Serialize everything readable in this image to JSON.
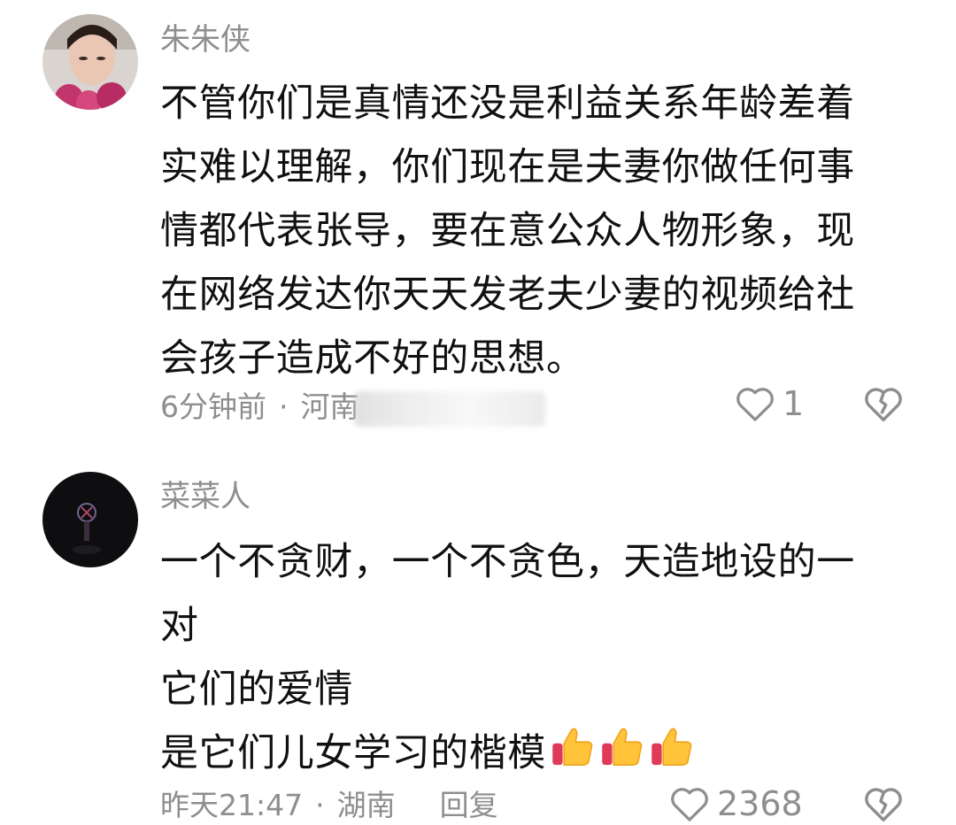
{
  "comments": [
    {
      "username": "朱朱侠",
      "text_lines": [
        "不管你们是真情还没是利益关系年龄差着",
        "实难以理解，你们现在是夫妻你做任何事",
        "情都代表张导，要在意公众人物形象，现",
        "在网络发达你天天发老夫少妻的视频给社",
        "会孩子造成不好的思想。"
      ],
      "time": "6分钟前",
      "separator": "·",
      "location": "河南",
      "reply_label": "回复",
      "like_count": "1",
      "avatar_icon": "user-photo-avatar-flowers",
      "like_icon": "heart-outline-icon",
      "dislike_icon": "broken-heart-icon"
    },
    {
      "username": "菜菜人",
      "text_lines": [
        "一个不贪财，一个不贪色，天造地设的一",
        "对",
        "它们的爱情",
        "是它们儿女学习的楷模"
      ],
      "emoji": [
        "thumbs-up",
        "thumbs-up",
        "thumbs-up"
      ],
      "time": "昨天21:47",
      "separator": "·",
      "location": "湖南",
      "reply_label": "回复",
      "like_count": "2368",
      "avatar_icon": "dark-photo-avatar",
      "like_icon": "heart-outline-icon",
      "dislike_icon": "broken-heart-icon"
    }
  ],
  "colors": {
    "text_primary": "#111111",
    "text_secondary": "#8e8e8e",
    "background": "#ffffff"
  }
}
